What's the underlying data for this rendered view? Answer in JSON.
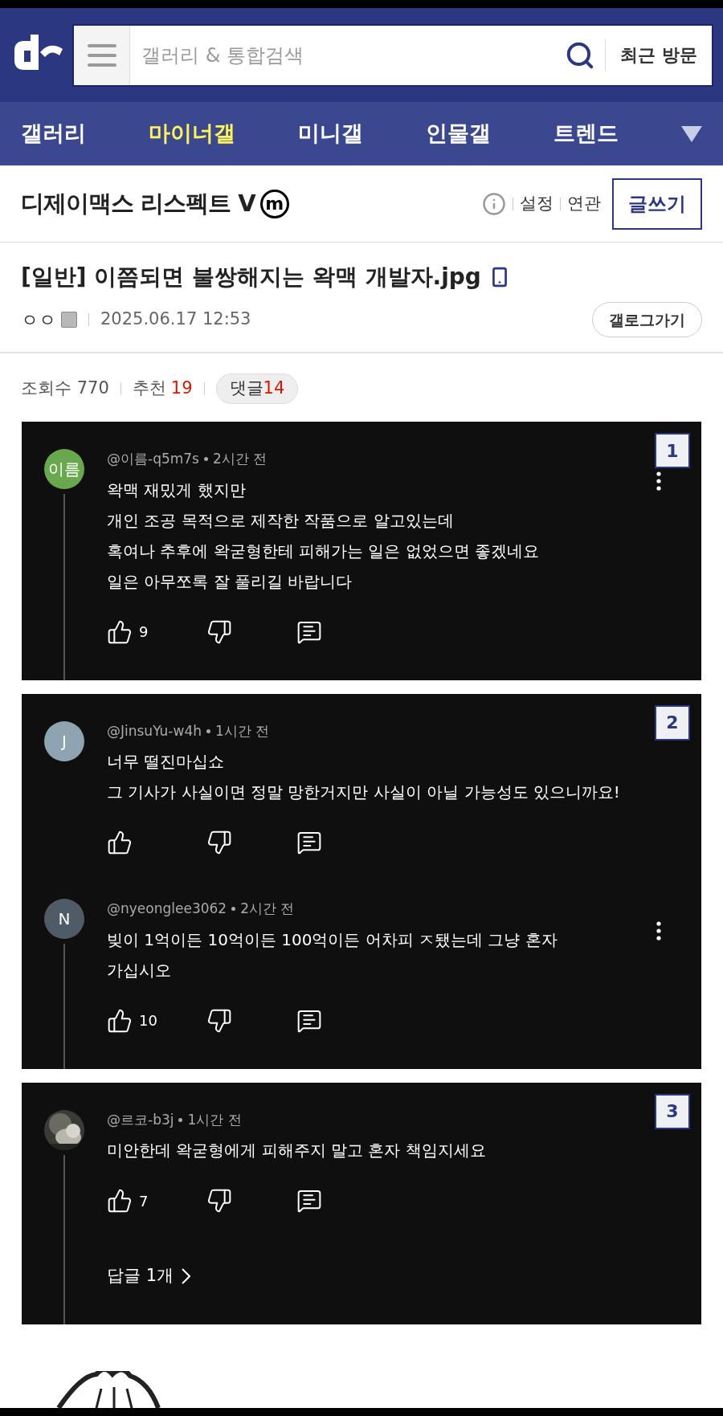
{
  "header": {
    "search_placeholder": "갤러리 & 통합검색",
    "recent_button": "최근 방문"
  },
  "nav": [
    {
      "label": "갤러리",
      "selected": false
    },
    {
      "label": "마이너갤",
      "selected": true
    },
    {
      "label": "미니갤",
      "selected": false
    },
    {
      "label": "인물갤",
      "selected": false
    },
    {
      "label": "트렌드",
      "selected": false
    }
  ],
  "gallery": {
    "title": "디제이맥스 리스펙트 V",
    "mark": "m",
    "links": [
      "설정",
      "연관"
    ],
    "write_button": "글쓰기"
  },
  "post": {
    "title": "[일반] 이쯤되면 불쌍해지는 왁맥 개발자.jpg",
    "author": "ㅇㅇ",
    "date": "2025.06.17 12:53",
    "gallog_button": "갤로그가기"
  },
  "stats": {
    "views_label": "조회수",
    "views": "770",
    "recommend_label": "추천",
    "recommend": "19",
    "comments_label": "댓글",
    "comments": "14"
  },
  "images": [
    {
      "badge": "1",
      "comments": [
        {
          "avatar": {
            "kind": "initials",
            "text": "이름",
            "color": "#6aa84f"
          },
          "handle": "@이름-q5m7s",
          "time": "2시간 전",
          "lines": [
            "왁맥 재밌게 했지만",
            "개인 조공 목적으로 제작한 작품으로 알고있는데",
            "혹여나 추후에 왁굳형한테 피해가는 일은 없었으면 좋겠네요",
            "일은 아무쪼록 잘 풀리길 바랍니다"
          ],
          "likes": "9",
          "menu": true,
          "thread": true
        }
      ]
    },
    {
      "badge": "2",
      "comments": [
        {
          "avatar": {
            "kind": "initials",
            "text": "J",
            "color": "#8ea4b3"
          },
          "handle": "@JinsuYu-w4h",
          "time": "1시간 전",
          "lines": [
            "너무 떨진마십쇼",
            "그 기사가 사실이면 정말 망한거지만 사실이 아닐 가능성도 있으니까요!"
          ],
          "menu": false,
          "thread": false
        },
        {
          "avatar": {
            "kind": "initials",
            "text": "N",
            "color": "#4f5b66"
          },
          "handle": "@nyeonglee3062",
          "time": "2시간 전",
          "lines": [
            "빚이 1억이든 10억이든 100억이든 어차피 ㅈ됐는데 그냥 혼자",
            "가십시오"
          ],
          "likes": "10",
          "menu": true,
          "thread": true
        }
      ]
    },
    {
      "badge": "3",
      "comments": [
        {
          "avatar": {
            "kind": "picture"
          },
          "handle": "@르코-b3j",
          "time": "1시간 전",
          "lines": [
            "미안한데 왁굳형에게 피해주지 말고 혼자 책임지세요"
          ],
          "likes": "7",
          "menu": false,
          "thread": true,
          "replies": "답글 1개"
        }
      ]
    }
  ]
}
